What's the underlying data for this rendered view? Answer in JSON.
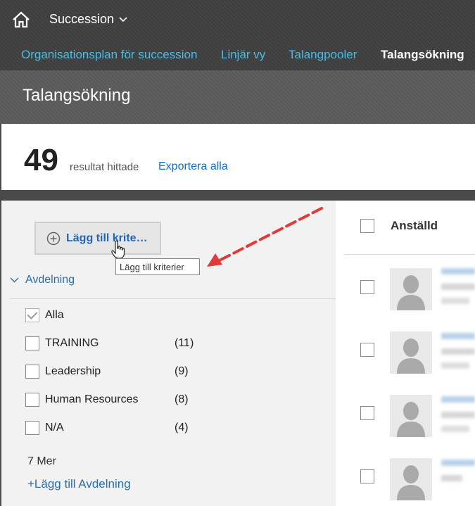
{
  "header": {
    "module": "Succession",
    "tabs": [
      {
        "label": "Organisationsplan för succession",
        "active": false
      },
      {
        "label": "Linjär vy",
        "active": false
      },
      {
        "label": "Talangpooler",
        "active": false
      },
      {
        "label": "Talangsökning",
        "active": true
      }
    ]
  },
  "page": {
    "title": "Talangsökning"
  },
  "results": {
    "count": "49",
    "found_label": "resultat hittade",
    "export_label": "Exportera alla"
  },
  "filters": {
    "add_button_label": "Lägg till krite…",
    "tooltip": "Lägg till kriterier",
    "section": {
      "title": "Avdelning",
      "options": [
        {
          "label": "Alla",
          "count": "",
          "checked": true
        },
        {
          "label": "TRAINING",
          "count": "(11)",
          "checked": false
        },
        {
          "label": "Leadership",
          "count": "(9)",
          "checked": false
        },
        {
          "label": "Human Resources",
          "count": "(8)",
          "checked": false
        },
        {
          "label": "N/A",
          "count": "(4)",
          "checked": false
        }
      ],
      "more_label": "7 Mer",
      "add_label": "+Lägg till Avdelning"
    }
  },
  "employees": {
    "column_header": "Anställd"
  },
  "colors": {
    "link": "#0a6ed1",
    "tab_link": "#4dbbe6",
    "annotation_arrow": "#e03a3a"
  }
}
